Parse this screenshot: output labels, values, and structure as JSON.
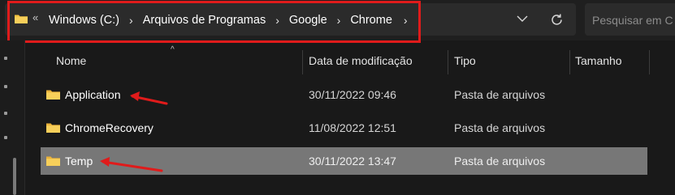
{
  "address_bar": {
    "overflow_chevron": "«",
    "breadcrumb": [
      "Windows (C:)",
      "Arquivos de Programas",
      "Google",
      "Chrome"
    ],
    "highlight_color": "#e01b1b"
  },
  "search": {
    "placeholder": "Pesquisar em C"
  },
  "columns": {
    "name": "Nome",
    "modified": "Data de modificação",
    "type": "Tipo",
    "size": "Tamanho"
  },
  "rows": [
    {
      "name": "Application",
      "modified": "30/11/2022 09:46",
      "type": "Pasta de arquivos",
      "size": ""
    },
    {
      "name": "ChromeRecovery",
      "modified": "11/08/2022 12:51",
      "type": "Pasta de arquivos",
      "size": ""
    },
    {
      "name": "Temp",
      "modified": "30/11/2022 13:47",
      "type": "Pasta de arquivos",
      "size": "",
      "selected": true
    }
  ],
  "icons": {
    "folder": "folder-icon",
    "dropdown": "chevron-down-icon",
    "refresh": "refresh-icon",
    "sort": "sort-up-icon"
  },
  "colors": {
    "folder_yellow": "#f3c242",
    "selected_row": "#777777",
    "annotation_red": "#e01b1b"
  }
}
